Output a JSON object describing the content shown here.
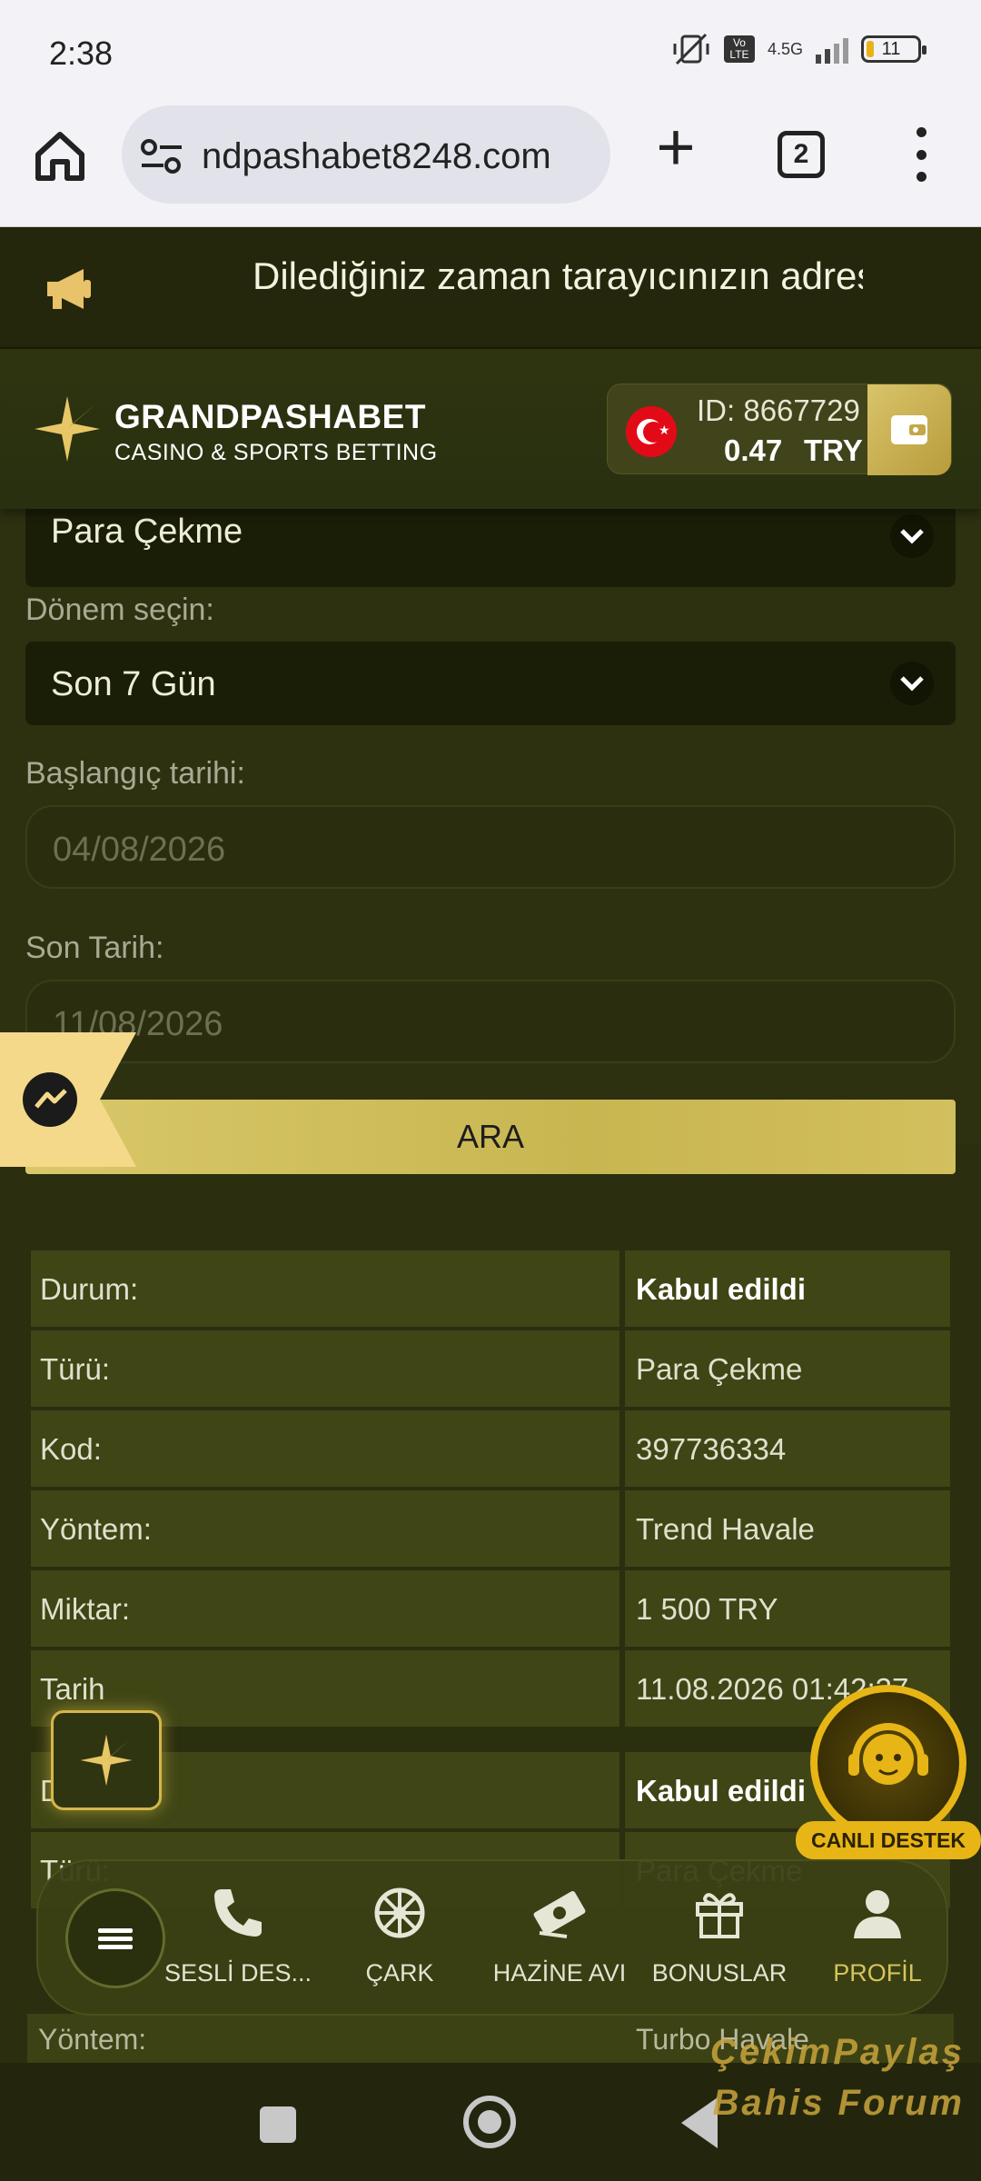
{
  "status_bar": {
    "time": "2:38",
    "network": "4.5G",
    "volte": "Vo LTE",
    "battery": "11"
  },
  "browser": {
    "url": "ndpashabet8248.com",
    "tab_count": "2"
  },
  "announcement": {
    "text": "Dilediğiniz zaman tarayıcınızın adresine"
  },
  "header": {
    "brand": "GRANDPASHABET",
    "tagline": "CASINO & SPORTS BETTING",
    "account_id": "ID: 8667729",
    "balance": "0.47",
    "currency": "TRY"
  },
  "form": {
    "type_value": "Para Çekme",
    "period_label": "Dönem seçin:",
    "period_value": "Son 7 Gün",
    "start_label": "Başlangıç tarihi:",
    "start_value": "04/08/2026",
    "end_label": "Son Tarih:",
    "end_value": "11/08/2026",
    "search_button": "ARA"
  },
  "transactions": [
    {
      "rows": [
        {
          "key": "Durum:",
          "value": "Kabul edildi"
        },
        {
          "key": "Türü:",
          "value": "Para Çekme"
        },
        {
          "key": "Kod:",
          "value": "397736334"
        },
        {
          "key": "Yöntem:",
          "value": "Trend Havale"
        },
        {
          "key": "Miktar:",
          "value": "1 500 TRY"
        },
        {
          "key": "Tarih",
          "value": "11.08.2026 01:42:37"
        }
      ]
    },
    {
      "rows": [
        {
          "key": "Durum:",
          "value": "Kabul edildi"
        },
        {
          "key": "Türü:",
          "value": "Para Çekme"
        }
      ]
    }
  ],
  "under_nav_row": {
    "key": "Yöntem:",
    "value": "Turbo Havale"
  },
  "support_label": "CANLI DESTEK",
  "bottom_nav": {
    "items": [
      {
        "label": "SESLİ DES...",
        "icon": "phone-icon"
      },
      {
        "label": "ÇARK",
        "icon": "wheel-icon"
      },
      {
        "label": "HAZİNE AVI",
        "icon": "money-icon"
      },
      {
        "label": "BONUSLAR",
        "icon": "gift-icon"
      },
      {
        "label": "PROFİL",
        "icon": "user-icon"
      }
    ]
  },
  "watermark": {
    "line1": "ÇekimPaylaş",
    "line2": "Bahis Forum"
  },
  "colors": {
    "accent_gold": "#d7c35a",
    "background": "#2d3110",
    "support_yellow": "#e7b515"
  }
}
